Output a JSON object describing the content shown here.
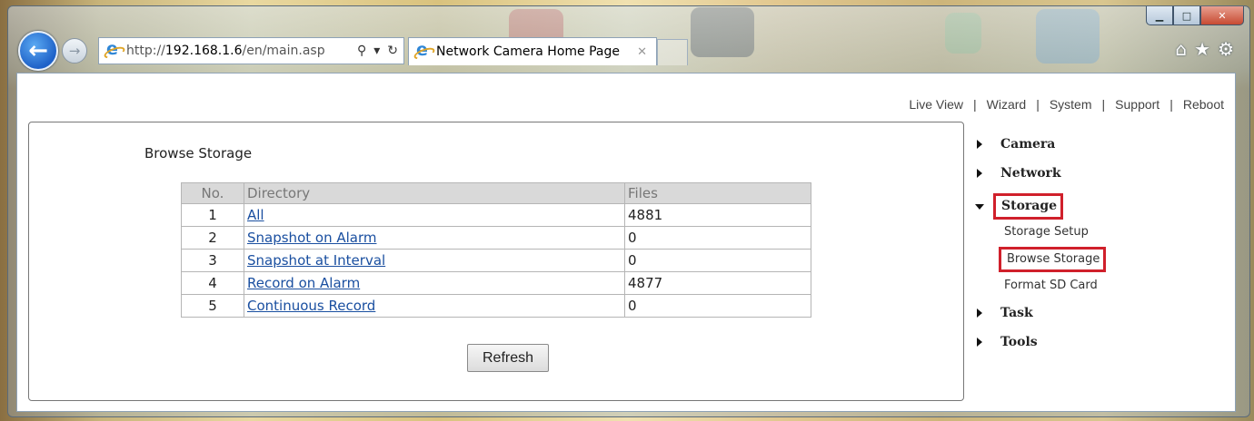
{
  "browser": {
    "address": {
      "prefix": "http://",
      "host": "192.168.1.6",
      "path": "/en/main.asp",
      "search_icon": "search-icon",
      "dropdown": "▾",
      "refresh_icon": "refresh-icon"
    },
    "tab": {
      "title": "Network Camera Home Page",
      "close": "✕"
    },
    "window_controls": {
      "minimize": "▁",
      "maximize": "□",
      "close": "✕"
    },
    "toolbar_icons": [
      "home-icon",
      "star-icon",
      "gear-icon"
    ]
  },
  "topnav": {
    "items": [
      "Live View",
      "Wizard",
      "System",
      "Support",
      "Reboot"
    ],
    "separator": "|"
  },
  "main": {
    "title": "Browse Storage",
    "table": {
      "headers": {
        "no": "No.",
        "directory": "Directory",
        "files": "Files"
      },
      "rows": [
        {
          "no": "1",
          "directory": "All",
          "files": "4881"
        },
        {
          "no": "2",
          "directory": "Snapshot on Alarm",
          "files": "0"
        },
        {
          "no": "3",
          "directory": "Snapshot at Interval",
          "files": "0"
        },
        {
          "no": "4",
          "directory": "Record on Alarm",
          "files": "4877"
        },
        {
          "no": "5",
          "directory": "Continuous Record",
          "files": "0"
        }
      ]
    },
    "refresh_label": "Refresh"
  },
  "sidebar": {
    "camera": "Camera",
    "network": "Network",
    "storage": "Storage",
    "storage_sub": [
      "Storage Setup",
      "Browse Storage",
      "Format SD Card"
    ],
    "task": "Task",
    "tools": "Tools"
  },
  "colors": {
    "highlight": "#d0202b",
    "link": "#1a4fa0",
    "header_bg": "#d9d9d9"
  }
}
